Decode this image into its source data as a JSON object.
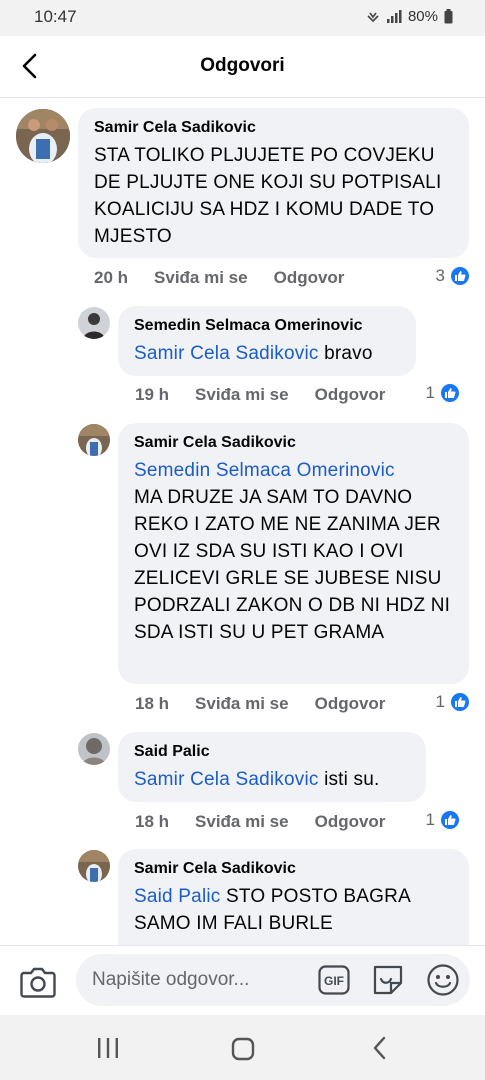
{
  "status_bar": {
    "time": "10:47",
    "battery": "80%"
  },
  "header": {
    "title": "Odgovori"
  },
  "actions": {
    "like": "Sviđa mi se",
    "reply": "Odgovor"
  },
  "comments": [
    {
      "author": "Samir Cela Sadikovic",
      "mention": "",
      "text": "STA TOLIKO PLJUJETE PO COVJEKU DE PLJUJTE ONE KOJI SU POTPISALI KOALICIJU SA HDZ I KOMU DADE TO MJESTO",
      "time": "20 h",
      "likes": "3"
    },
    {
      "author": "Semedin Selmaca Omerinovic",
      "mention": "Samir Cela Sadikovic",
      "text": "bravo",
      "time": "19 h",
      "likes": "1"
    },
    {
      "author": "Samir Cela Sadikovic",
      "mention": "Semedin Selmaca Omerinovic",
      "text": "MA DRUZE JA SAM TO DAVNO REKO I ZATO ME NE ZANIMA JER OVI IZ SDA SU ISTI KAO I OVI ZELICEVI GRLE SE JUBESE NISU PODRZALI ZAKON O DB NI HDZ NI SDA ISTI SU U PET GRAMA",
      "time": "18 h",
      "likes": "1"
    },
    {
      "author": "Said Palic",
      "mention": "Samir Cela Sadikovic",
      "text": "isti su.",
      "time": "18 h",
      "likes": "1"
    },
    {
      "author": "Samir Cela Sadikovic",
      "mention": "Said Palic",
      "text": "STO POSTO BAGRA SAMO IM FALI BURLE",
      "time": "",
      "likes": ""
    }
  ],
  "composer": {
    "placeholder": "Napišite odgovor...",
    "gif_label": "GIF"
  },
  "colors": {
    "accent": "#1877f2",
    "mention": "#1b5cc8",
    "bubble": "#f0f2f5",
    "meta": "#65676b"
  },
  "icons": [
    "back-arrow-icon",
    "camera-icon",
    "gif-icon",
    "sticker-icon",
    "emoji-icon",
    "like-icon",
    "recent-apps-icon",
    "home-icon",
    "nav-back-icon",
    "wifi-icon",
    "signal-icon",
    "battery-icon"
  ]
}
